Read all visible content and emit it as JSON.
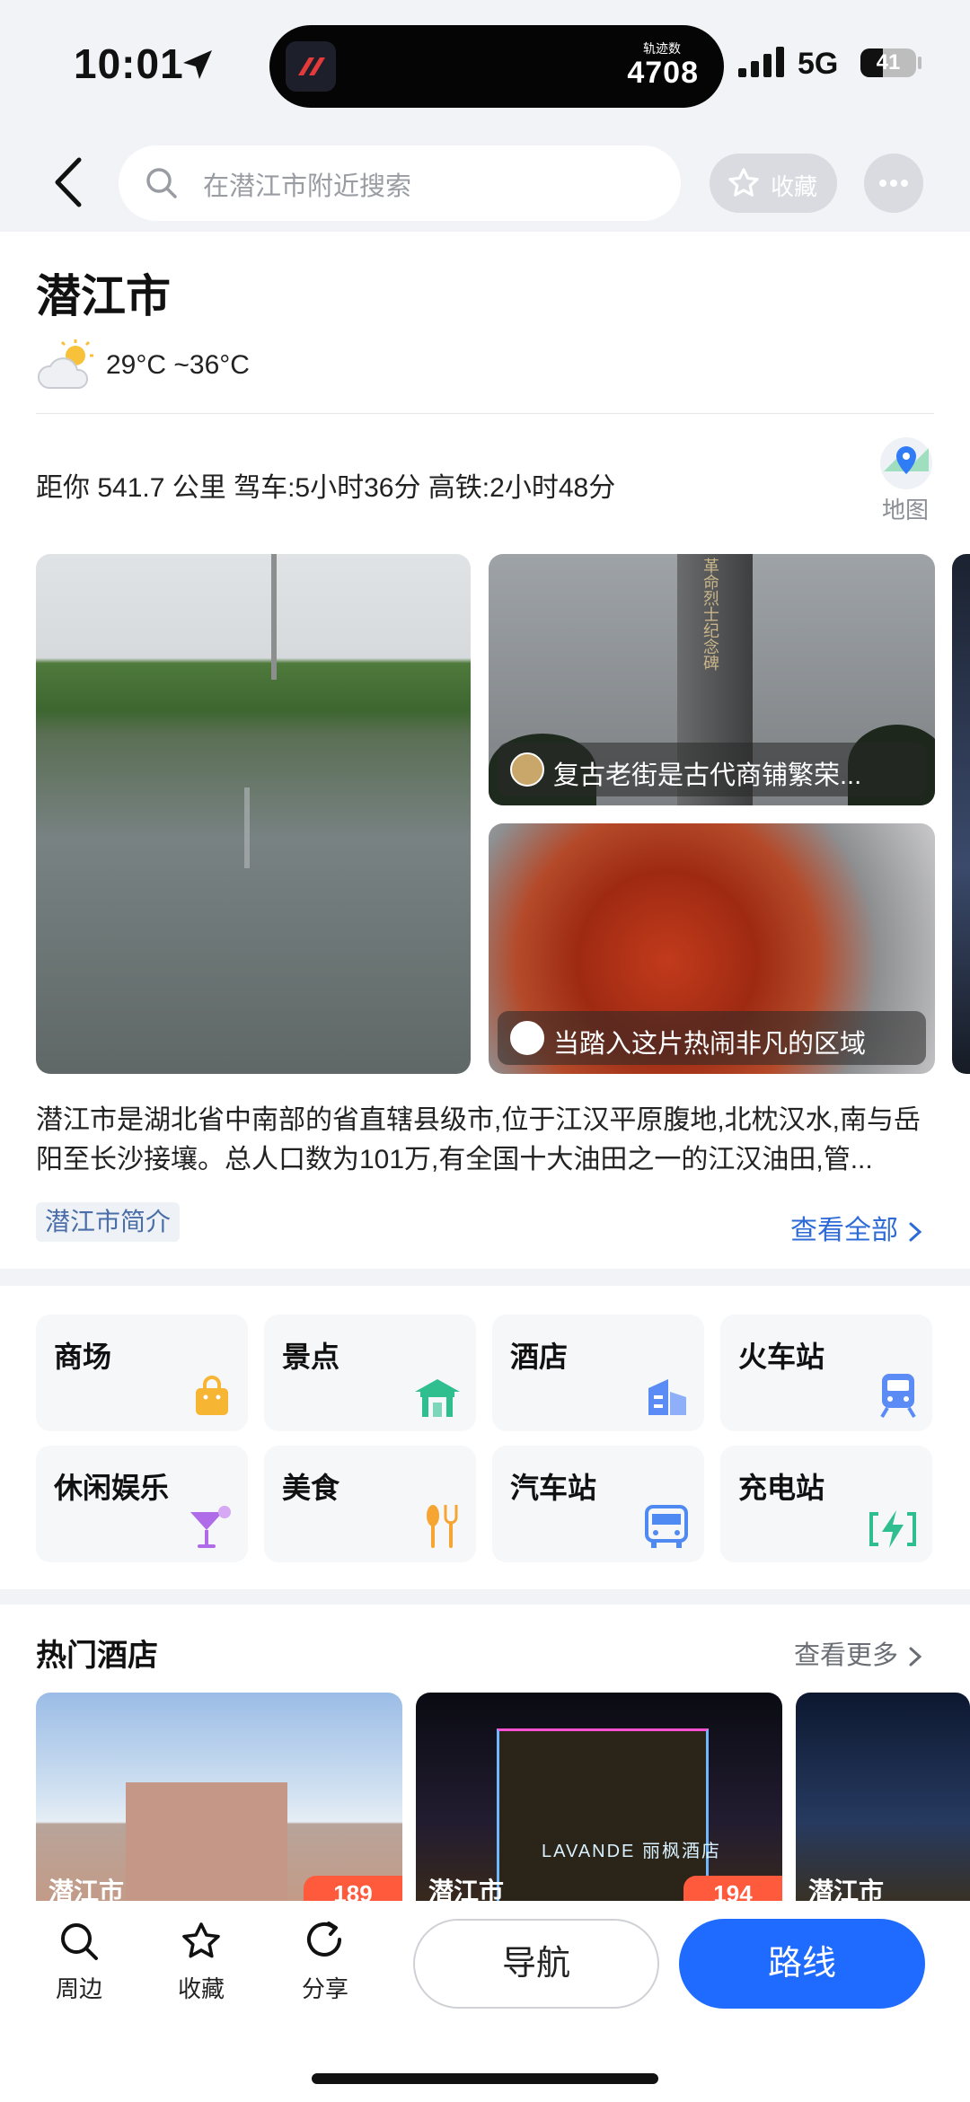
{
  "status": {
    "time": "10:01",
    "island_label": "轨迹数",
    "island_value": "4708",
    "network": "5G",
    "battery": "41",
    "battery_level": 0.41
  },
  "header": {
    "search_placeholder": "在潜江市附近搜索",
    "favorite_label": "收藏"
  },
  "city": {
    "name": "潜江市",
    "temperature": "29°C ~36°C",
    "distance": "距你 541.7 公里  驾车:5小时36分  高铁:2小时48分",
    "map_label": "地图",
    "photos": [
      {
        "caption": "复古老街是古代商铺繁荣..."
      },
      {
        "caption": "当踏入这片热闹非凡的区域"
      }
    ],
    "monument_text": "革命烈士纪念碑",
    "intro": "潜江市是湖北省中南部的省直辖县级市,位于江汉平原腹地,北枕汉水,南与岳阳至长沙接壤。总人口数为101万,有全国十大油田之一的江汉油田,管...",
    "intro_tag": "潜江市简介",
    "see_all": "查看全部"
  },
  "categories": [
    {
      "label": "商场",
      "icon": "shopping-bag-icon",
      "color": "#f6b532"
    },
    {
      "label": "景点",
      "icon": "pavilion-icon",
      "color": "#2fbf8f"
    },
    {
      "label": "酒店",
      "icon": "building-icon",
      "color": "#5b8cf5"
    },
    {
      "label": "火车站",
      "icon": "train-icon",
      "color": "#5b8cf5"
    },
    {
      "label": "休闲娱乐",
      "icon": "cocktail-icon",
      "color": "#b06be8"
    },
    {
      "label": "美食",
      "icon": "fork-spoon-icon",
      "color": "#f6a532"
    },
    {
      "label": "汽车站",
      "icon": "bus-icon",
      "color": "#4f8af3"
    },
    {
      "label": "充电站",
      "icon": "charging-icon",
      "color": "#2fbf8f"
    }
  ],
  "hotels": {
    "title": "热门酒店",
    "more": "查看更多",
    "items": [
      {
        "caption": "潜江市",
        "price": "189"
      },
      {
        "caption": "潜江市",
        "price": "194"
      },
      {
        "caption": "潜江市"
      }
    ],
    "sign_text": "LAVANDE 丽枫酒店"
  },
  "bottom": {
    "nearby": "周边",
    "favorite": "收藏",
    "share": "分享",
    "navigate": "导航",
    "route": "路线"
  }
}
